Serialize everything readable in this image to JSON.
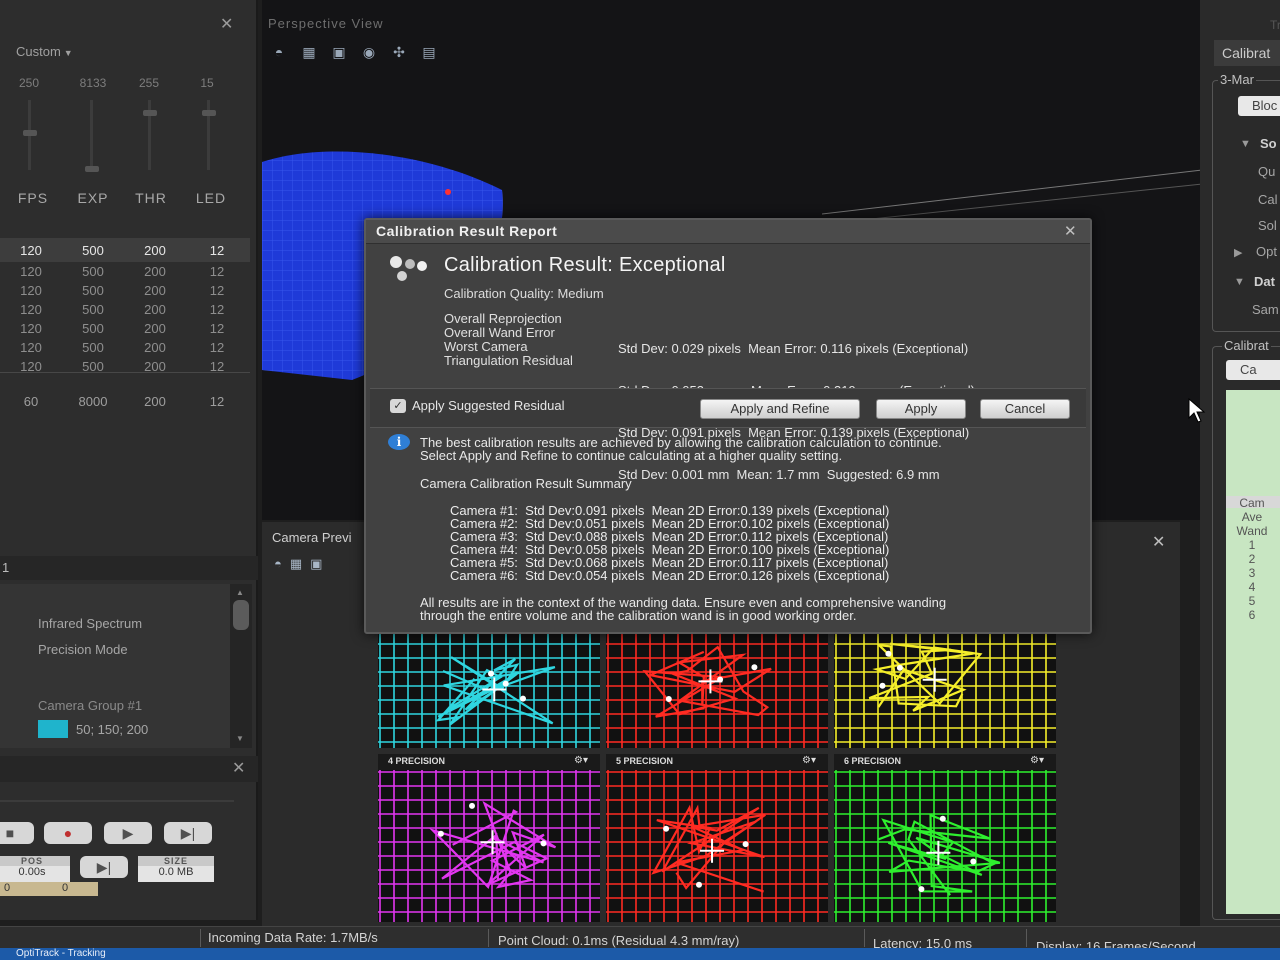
{
  "left_panel": {
    "preset": "Custom",
    "slider_values": [
      "250",
      "8133",
      "255",
      "15"
    ],
    "columns": [
      "FPS",
      "EXP",
      "THR",
      "LED"
    ],
    "camera_rows": [
      [
        "120",
        "500",
        "200",
        "12"
      ],
      [
        "120",
        "500",
        "200",
        "12"
      ],
      [
        "120",
        "500",
        "200",
        "12"
      ],
      [
        "120",
        "500",
        "200",
        "12"
      ],
      [
        "120",
        "500",
        "200",
        "12"
      ],
      [
        "120",
        "500",
        "200",
        "12"
      ],
      [
        "120",
        "500",
        "200",
        "12"
      ]
    ],
    "reference_row": [
      "60",
      "8000",
      "200",
      "12"
    ],
    "properties_header": "1",
    "properties": {
      "infrared": "Infrared Spectrum",
      "precision": "Precision Mode",
      "group": "Camera Group #1",
      "color_value": "50; 150; 200",
      "color_swatch": "#1fb4cc"
    },
    "playback": {
      "pos_label": "POS",
      "pos_value": "0.00s",
      "size_label": "SIZE",
      "size_value": "0.0 MB",
      "strip_values": [
        "0",
        "0"
      ]
    }
  },
  "perspective": {
    "title": "Perspective View"
  },
  "camera_preview": {
    "title": "Camera Previ",
    "cells": [
      {
        "label": "",
        "color": "#2fd6e0"
      },
      {
        "label": "",
        "color": "#ff2b22"
      },
      {
        "label": "",
        "color": "#f5ee2a"
      },
      {
        "label": "4   PRECISION",
        "color": "#e236f0"
      },
      {
        "label": "5   PRECISION",
        "color": "#ff2b22"
      },
      {
        "label": "6   PRECISION",
        "color": "#2ef02e"
      }
    ]
  },
  "right_panel": {
    "title": "Track",
    "tab": "Calibrat",
    "section1_legend": "3-Mar",
    "button1": "Bloc",
    "group1": "So",
    "items": [
      "Qu",
      "Cal",
      "Sol",
      "Opt",
      "Dat",
      "Sam"
    ],
    "section2_legend": "Calibrat",
    "button2": "Ca",
    "list_head": [
      "Cam",
      "Ave",
      "Wand"
    ],
    "list_items": [
      "1",
      "2",
      "3",
      "4",
      "5",
      "6"
    ]
  },
  "dialog": {
    "title": "Calibration Result Report",
    "result": "Calibration Result: Exceptional",
    "quality": "Calibration Quality: Medium",
    "metric_labels": [
      "Overall Reprojection",
      "Overall Wand Error",
      "Worst Camera",
      "Triangulation Residual"
    ],
    "metric_values": [
      "Std Dev: 0.029 pixels  Mean Error: 0.116 pixels (Exceptional)",
      "Std Dev: 0.053 mm      Mean Error: 0.319 mm     (Exceptional)",
      "Std Dev: 0.091 pixels  Mean Error: 0.139 pixels (Exceptional)",
      "Std Dev: 0.001 mm  Mean: 1.7 mm  Suggested: 6.9 mm"
    ],
    "apply_residual_label": "Apply Suggested Residual",
    "btn_apply_refine": "Apply and Refine",
    "btn_apply": "Apply",
    "btn_cancel": "Cancel",
    "info_line1": "The best calibration results are achieved by allowing the calibration calculation to continue.",
    "info_line2": "Select Apply and Refine to continue calculating at a higher quality setting.",
    "summary_title": "Camera Calibration Result Summary",
    "summary_rows": [
      "Camera #1:  Std Dev:0.091 pixels  Mean 2D Error:0.139 pixels (Exceptional)",
      "Camera #2:  Std Dev:0.051 pixels  Mean 2D Error:0.102 pixels (Exceptional)",
      "Camera #3:  Std Dev:0.088 pixels  Mean 2D Error:0.112 pixels (Exceptional)",
      "Camera #4:  Std Dev:0.058 pixels  Mean 2D Error:0.100 pixels (Exceptional)",
      "Camera #5:  Std Dev:0.068 pixels  Mean 2D Error:0.117 pixels (Exceptional)",
      "Camera #6:  Std Dev:0.054 pixels  Mean 2D Error:0.126 pixels (Exceptional)"
    ],
    "footer_line1": "All results are in the context of the wanding data.  Ensure even and comprehensive wanding",
    "footer_line2": "through the entire volume and the calibration wand is in good working order."
  },
  "status_bar": {
    "incoming": "Incoming Data Rate: 1.7MB/s",
    "point_cloud": "Point Cloud: 0.1ms (Residual 4.3 mm/ray)",
    "latency": "Latency: 15.0 ms",
    "display": "Display: 16 Frames/Second"
  },
  "taskbar": {
    "app": "OptiTrack - Tracking"
  }
}
